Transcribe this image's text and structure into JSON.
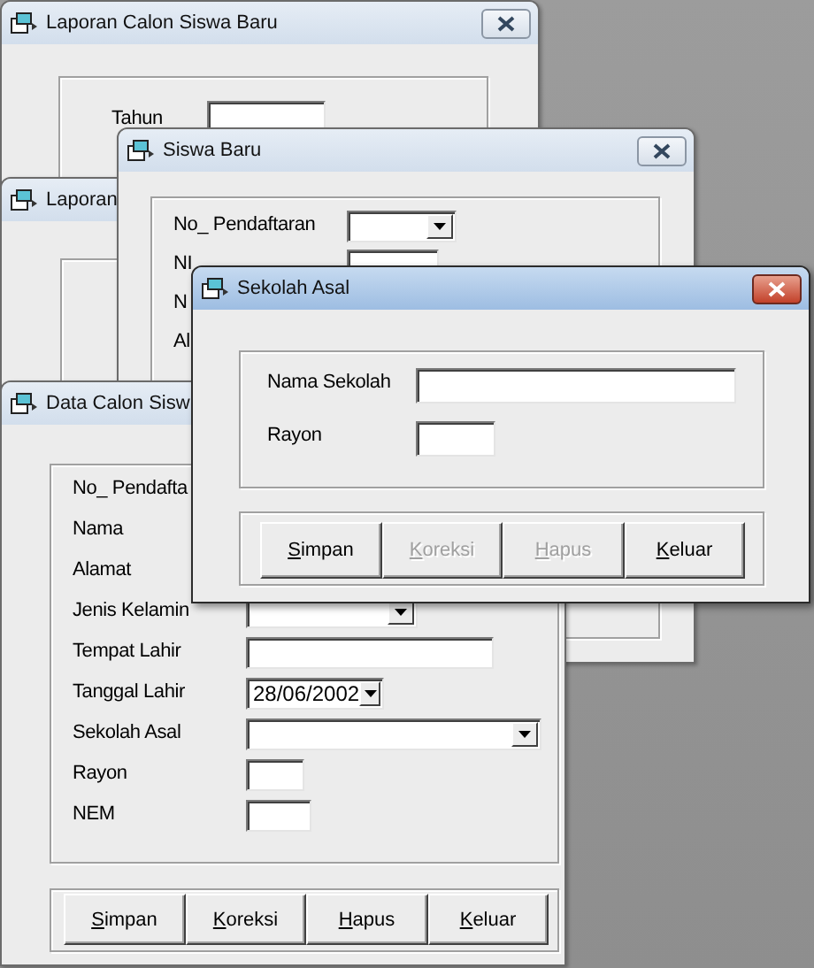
{
  "windows": [
    {
      "title": "Laporan Calon Siswa Baru",
      "active": false,
      "fields": [
        {
          "label": "Tahun",
          "kind": "textbox"
        }
      ]
    },
    {
      "title": "Laporan",
      "active": false
    },
    {
      "title": "Siswa Baru",
      "active": false,
      "fields": [
        {
          "label": "No_ Pendaftaran",
          "kind": "combo"
        },
        {
          "label": "NI",
          "kind": "textbox"
        },
        {
          "label": "N",
          "kind": "none"
        },
        {
          "label": "Al",
          "kind": "none"
        }
      ]
    },
    {
      "title": "Data Calon Sisw",
      "active": false,
      "fields": [
        {
          "label": "No_ Pendafta",
          "kind": "none"
        },
        {
          "label": "Nama",
          "kind": "none"
        },
        {
          "label": "Alamat",
          "kind": "none"
        },
        {
          "label": "Jenis Kelamin",
          "kind": "combo"
        },
        {
          "label": "Tempat Lahir",
          "kind": "textbox"
        },
        {
          "label": "Tanggal Lahir",
          "kind": "combo",
          "value": "28/06/2002"
        },
        {
          "label": "Sekolah Asal",
          "kind": "combo"
        },
        {
          "label": "Rayon",
          "kind": "textbox"
        },
        {
          "label": "NEM",
          "kind": "textbox"
        }
      ],
      "buttons": [
        {
          "label": "Simpan",
          "disabled": false
        },
        {
          "label": "Koreksi",
          "disabled": false
        },
        {
          "label": "Hapus",
          "disabled": false
        },
        {
          "label": "Keluar",
          "disabled": false
        }
      ]
    },
    {
      "title": "Sekolah Asal",
      "active": true,
      "fields": [
        {
          "label": "Nama Sekolah",
          "kind": "textbox"
        },
        {
          "label": "Rayon",
          "kind": "textbox"
        }
      ],
      "buttons": [
        {
          "label": "Simpan",
          "disabled": false
        },
        {
          "label": "Koreksi",
          "disabled": true
        },
        {
          "label": "Hapus",
          "disabled": true
        },
        {
          "label": "Keluar",
          "disabled": false
        }
      ]
    }
  ]
}
